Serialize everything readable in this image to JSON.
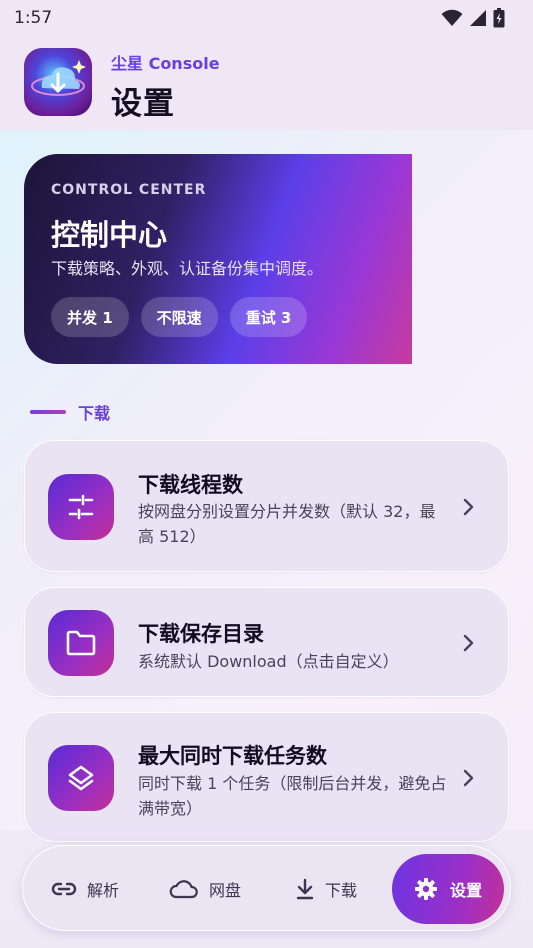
{
  "status_bar": {
    "time": "1:57"
  },
  "header": {
    "app_subtitle": "尘星 Console",
    "page_title": "设置"
  },
  "hero": {
    "kicker": "CONTROL CENTER",
    "title": "控制中心",
    "description": "下载策略、外观、认证备份集中调度。",
    "chips": [
      {
        "label": "并发 1"
      },
      {
        "label": "不限速"
      },
      {
        "label": "重试 3"
      }
    ]
  },
  "section": {
    "title": "下载"
  },
  "settings": [
    {
      "title": "下载线程数",
      "description": "按网盘分别设置分片并发数（默认 32，最高 512）",
      "icon": "tune-sliders-icon"
    },
    {
      "title": "下载保存目录",
      "description": "系统默认 Download（点击自定义）",
      "icon": "folder-icon"
    },
    {
      "title": "最大同时下载任务数",
      "description": "同时下载 1 个任务（限制后台并发，避免占满带宽）",
      "icon": "layers-icon"
    }
  ],
  "bottom_nav": {
    "items": [
      {
        "label": "解析",
        "icon": "link-icon"
      },
      {
        "label": "网盘",
        "icon": "cloud-icon"
      },
      {
        "label": "下载",
        "icon": "download-icon"
      },
      {
        "label": "设置",
        "icon": "gear-icon",
        "active": true
      }
    ]
  },
  "colors": {
    "accent": "#6a3fe0",
    "accent_end": "#c23196",
    "hero_dark": "#1c1538",
    "card_bg": "#e9e2f3"
  }
}
